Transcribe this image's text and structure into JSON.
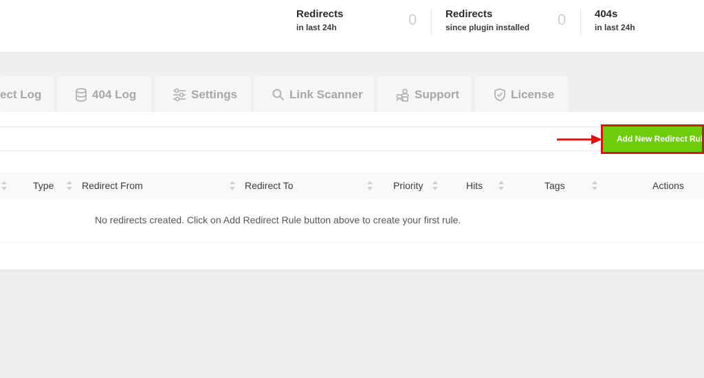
{
  "stats": [
    {
      "title": "Redirects",
      "sub": "in last 24h",
      "count": "0"
    },
    {
      "title": "Redirects",
      "sub": "since plugin installed",
      "count": "0"
    },
    {
      "title": "404s",
      "sub": "in last 24h",
      "count": ""
    }
  ],
  "tabs": [
    {
      "label": "ect Log",
      "icon": "none"
    },
    {
      "label": "404 Log",
      "icon": "database-icon"
    },
    {
      "label": "Settings",
      "icon": "sliders-icon"
    },
    {
      "label": "Link Scanner",
      "icon": "search-icon"
    },
    {
      "label": "Support",
      "icon": "support-icon"
    },
    {
      "label": "License",
      "icon": "shield-check-icon"
    }
  ],
  "toolbar": {
    "add_button": "Add New Redirect Rule"
  },
  "table": {
    "columns": [
      "Type",
      "Redirect From",
      "Redirect To",
      "Priority",
      "Hits",
      "Tags",
      "Actions"
    ],
    "empty_message": "No redirects created. Click on Add Redirect Rule button above to create your first rule."
  },
  "colors": {
    "accent_button": "#6ecc0a",
    "highlight": "#e01010"
  }
}
